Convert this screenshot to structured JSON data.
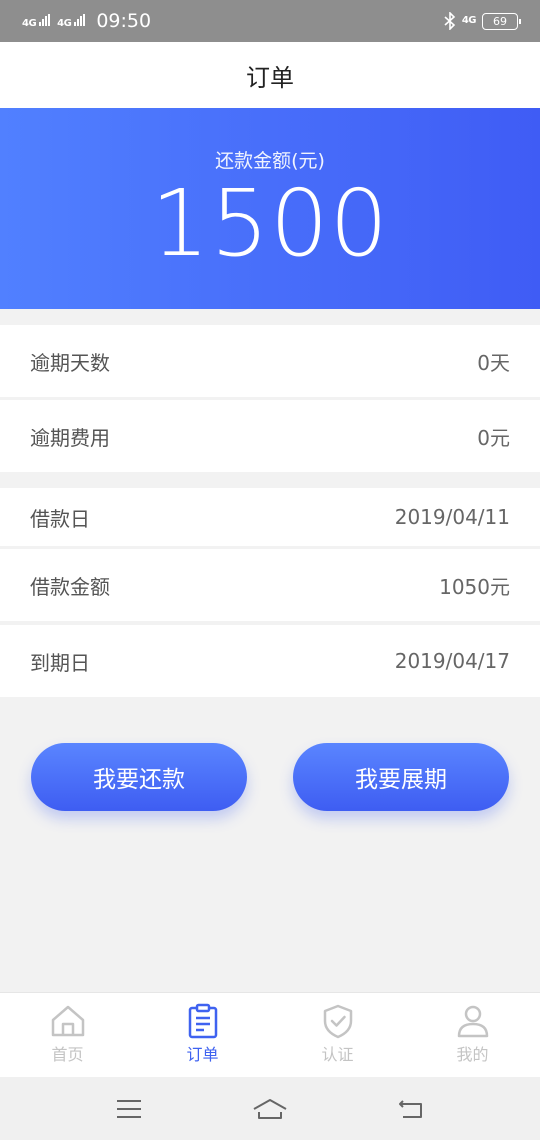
{
  "status_bar": {
    "network_1": "4G",
    "network_2": "4G",
    "time": "09:50",
    "network_3": "4G",
    "battery": "69"
  },
  "header": {
    "title": "订单"
  },
  "banner": {
    "label": "还款金额(元)",
    "amount": "1500"
  },
  "details": [
    {
      "label": "逾期天数",
      "value": "0天"
    },
    {
      "label": "逾期费用",
      "value": "0元"
    },
    {
      "label": "借款日",
      "value": "2019/04/11"
    },
    {
      "label": "借款金额",
      "value": "1050元"
    },
    {
      "label": "到期日",
      "value": "2019/04/17"
    }
  ],
  "actions": {
    "repay": "我要还款",
    "extend": "我要展期"
  },
  "tabs": [
    {
      "label": "首页",
      "icon": "home-icon"
    },
    {
      "label": "订单",
      "icon": "order-icon",
      "active": true
    },
    {
      "label": "认证",
      "icon": "shield-check-icon"
    },
    {
      "label": "我的",
      "icon": "user-icon"
    }
  ],
  "colors": {
    "accent": "#3f62f0",
    "banner_start": "#5180ff",
    "banner_end": "#3f5cf5",
    "tab_inactive": "#c4c4c4"
  }
}
